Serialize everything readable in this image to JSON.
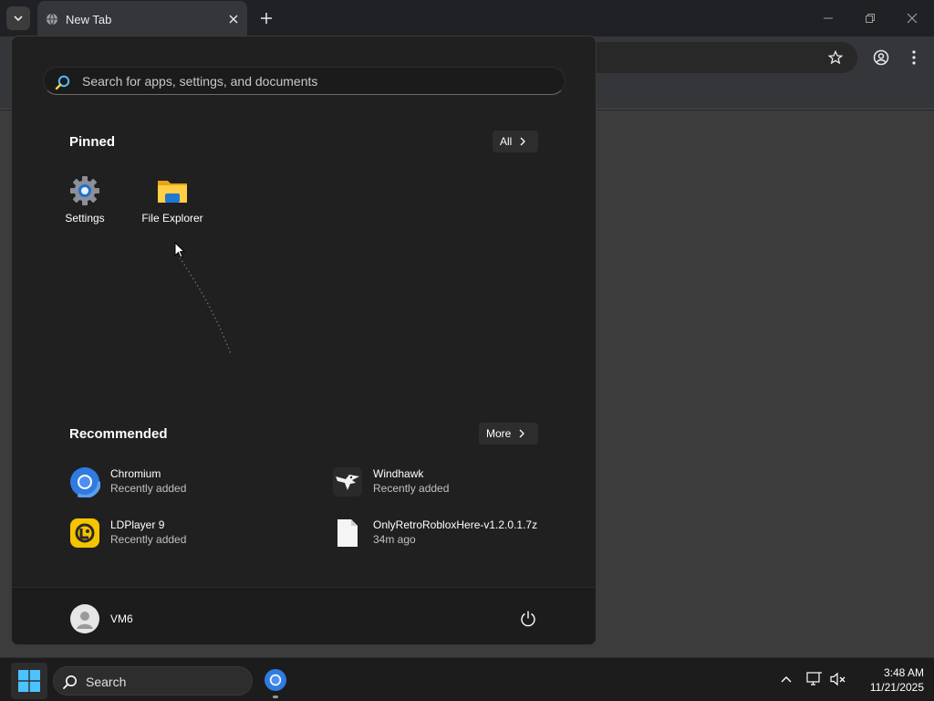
{
  "browser": {
    "tab_title": "New Tab",
    "icons": [
      "tab-list-icon",
      "globe-icon",
      "close-icon",
      "plus-icon",
      "minimize-icon",
      "restore-icon",
      "close-window-icon",
      "star-icon",
      "profile-icon",
      "menu-icon"
    ]
  },
  "start_menu": {
    "search": {
      "placeholder": "Search for apps, settings, and documents",
      "value": ""
    },
    "pinned": {
      "title": "Pinned",
      "all_label": "All",
      "apps": [
        {
          "label": "Settings",
          "icon": "settings-gear-icon"
        },
        {
          "label": "File Explorer",
          "icon": "folder-icon"
        }
      ]
    },
    "recommended": {
      "title": "Recommended",
      "more_label": "More",
      "items": [
        {
          "name": "Chromium",
          "subtitle": "Recently added",
          "icon": "chromium-icon"
        },
        {
          "name": "Windhawk",
          "subtitle": "Recently added",
          "icon": "windhawk-icon"
        },
        {
          "name": "LDPlayer 9",
          "subtitle": "Recently added",
          "icon": "ldplayer-icon"
        },
        {
          "name": "OnlyRetroRobloxHere-v1.2.0.1.7z",
          "subtitle": "34m ago",
          "icon": "file-icon"
        }
      ]
    },
    "user": {
      "name": "VM6"
    },
    "power_icon": "power-icon"
  },
  "taskbar": {
    "search_label": "Search",
    "clock": {
      "time": "3:48 AM",
      "date": "11/21/2025"
    },
    "tray_icons": [
      "chevron-up-icon",
      "network-icon",
      "volume-muted-icon"
    ]
  },
  "colors": {
    "accent": "#4cc2ff",
    "start_bg": "#202020",
    "taskbar_bg": "#1c1c1c"
  }
}
